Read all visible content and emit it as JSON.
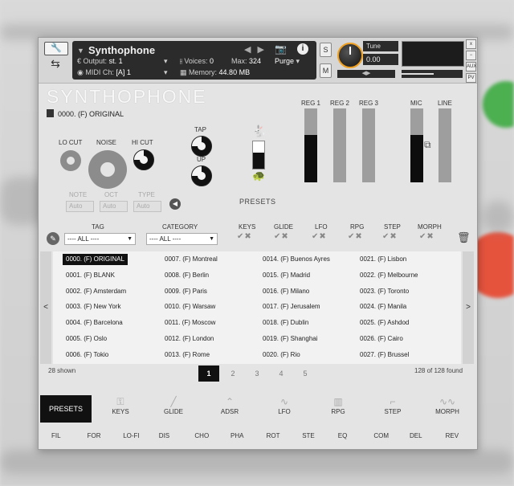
{
  "header": {
    "instrument_name": "Synthophone",
    "output_label": "Output:",
    "output_value": "st. 1",
    "voices_label": "Voices:",
    "voices_value": "0",
    "max_label": "Max:",
    "max_value": "324",
    "purge_label": "Purge",
    "midi_label": "MIDI Ch:",
    "midi_value": "[A] 1",
    "memory_label": "Memory:",
    "memory_value": "44.80 MB",
    "s_label": "S",
    "m_label": "M",
    "tune_label": "Tune",
    "tune_value": "0.00",
    "pan_label": "◀▶",
    "side_buttons": [
      "x",
      "−",
      "AUX",
      "PV"
    ]
  },
  "main": {
    "title": "SYNTHOPHONE",
    "preset_name": "0000. (F) ORIGINAL",
    "controls": {
      "lo_cut": "LO CUT",
      "noise": "NOISE",
      "hi_cut": "HI CUT",
      "tap": "TAP",
      "up": "UP",
      "note": "NOTE",
      "oct": "OCT",
      "type": "TYPE",
      "note_value": "Auto",
      "oct_value": "Auto",
      "type_value": "Auto"
    },
    "sliders": [
      {
        "label": "REG 1",
        "level": 0.64
      },
      {
        "label": "REG 2",
        "level": 0.0
      },
      {
        "label": "REG 3",
        "level": 0.0
      },
      {
        "label": "MIC",
        "level": 0.64
      },
      {
        "label": "LINE",
        "level": 0.0
      }
    ],
    "presets_label": "PRESETS"
  },
  "filters": {
    "tag_label": "TAG",
    "tag_value": "---- ALL ----",
    "category_label": "CATEGORY",
    "category_value": "---- ALL ----",
    "toggles": [
      "KEYS",
      "GLIDE",
      "LFO",
      "RPG",
      "STEP",
      "MORPH"
    ]
  },
  "presets": {
    "columns": [
      [
        "0000. (F) ORIGINAL",
        "0001. (F) BLANK",
        "0002. (F) Amsterdam",
        "0003. (F) New York",
        "0004. (F) Barcelona",
        "0005. (F) Oslo",
        "0006. (F) Tokio"
      ],
      [
        "0007. (F) Montreal",
        "0008. (F) Berlin",
        "0009. (F) Paris",
        "0010. (F) Warsaw",
        "0011. (F) Moscow",
        "0012. (F) London",
        "0013. (F) Rome"
      ],
      [
        "0014. (F) Buenos Ayres",
        "0015. (F) Madrid",
        "0016. (F) Milano",
        "0017. (F) Jerusalem",
        "0018. (F) Dublin",
        "0019. (F) Shanghai",
        "0020. (F) Rio"
      ],
      [
        "0021. (F) Lisbon",
        "0022. (F) Melbourne",
        "0023. (F) Toronto",
        "0024. (F) Manila",
        "0025. (F) Ashdod",
        "0026. (F) Cairo",
        "0027. (F) Brussel"
      ]
    ],
    "selected": "0000. (F) ORIGINAL",
    "shown_text": "28 shown",
    "found_text": "128 of 128 found",
    "pages": [
      "1",
      "2",
      "3",
      "4",
      "5"
    ],
    "current_page": "1",
    "prev": "<",
    "next": ">"
  },
  "tabs": [
    "PRESETS",
    "KEYS",
    "GLIDE",
    "ADSR",
    "LFO",
    "RPG",
    "STEP",
    "MORPH"
  ],
  "fx": [
    "FIL",
    "FOR",
    "LO-FI",
    "DIS",
    "CHO",
    "PHA",
    "ROT",
    "STE",
    "EQ",
    "COM",
    "DEL",
    "REV"
  ]
}
